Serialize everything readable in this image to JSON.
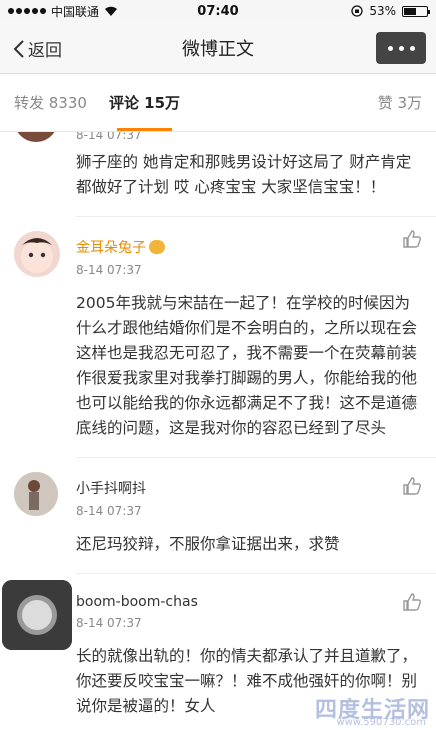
{
  "status_bar": {
    "carrier": "中国联通",
    "time": "07:40",
    "battery": "53%",
    "battery_level": 0.53
  },
  "nav": {
    "back_label": "返回",
    "title": "微博正文"
  },
  "tabs": {
    "repost": "转发 8330",
    "comments": "评论 15万",
    "likes": "赞 3万"
  },
  "comments": [
    {
      "name": "",
      "time": "8-14 07:37",
      "text": "狮子座的 她肯定和那贱男设计好这局了 财产肯定都做好了计划 哎 心疼宝宝 大家坚信宝宝！！"
    },
    {
      "name": "金耳朵兔子",
      "time": "8-14 07:37",
      "text": "2005年我就与宋喆在一起了！在学校的时候因为什么才跟他结婚你们是不会明白的，之所以现在会这样也是我忍无可忍了，我不需要一个在荧幕前装作很爱我家里对我拳打脚踢的男人，你能给我的他也可以能给我的你永远都满足不了我！这不是道德底线的问题，这是我对你的容忍已经到了尽头"
    },
    {
      "name": "小手抖啊抖",
      "time": "8-14 07:37",
      "text": "还尼玛狡辩，不服你拿证据出来，求赞"
    },
    {
      "name": "boom-boom-chas",
      "time": "8-14 07:37",
      "text": "长的就像出轨的！你的情夫都承认了并且道歉了，你还要反咬宝宝一嘛？！难不成他强奸的你啊！别说你是被逼的！女人"
    }
  ],
  "watermark": {
    "text": "四度生活网",
    "url": "www.590730.com"
  },
  "colors": {
    "accent": "#ff8200",
    "vip_name": "#e98c00"
  }
}
